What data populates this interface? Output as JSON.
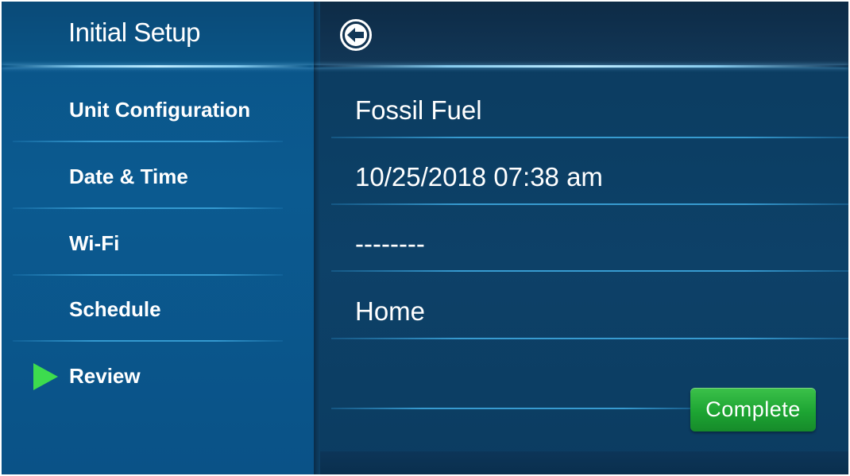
{
  "sidebar": {
    "title": "Initial Setup",
    "items": [
      {
        "label": "Unit Configuration",
        "active": false
      },
      {
        "label": "Date & Time",
        "active": false
      },
      {
        "label": "Wi-Fi",
        "active": false
      },
      {
        "label": "Schedule",
        "active": false
      },
      {
        "label": "Review",
        "active": true
      }
    ]
  },
  "header": {
    "back_icon": "back-arrow-circle-icon"
  },
  "review": {
    "rows": [
      {
        "value": "Fossil Fuel"
      },
      {
        "value": "10/25/2018 07:38 am"
      },
      {
        "value": "--------"
      },
      {
        "value": "Home"
      }
    ]
  },
  "actions": {
    "complete_label": "Complete"
  },
  "colors": {
    "accent_green": "#1da533",
    "active_arrow": "#3ddc4e",
    "sidebar_blue": "#0a5487",
    "main_blue": "#0c3c61",
    "text": "#ffffff"
  }
}
